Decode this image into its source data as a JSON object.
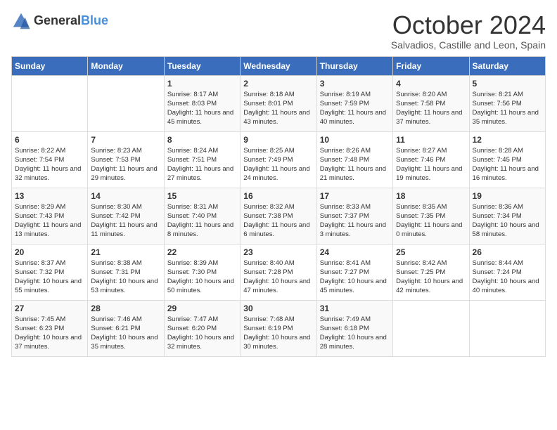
{
  "logo": {
    "general": "General",
    "blue": "Blue"
  },
  "title": "October 2024",
  "subtitle": "Salvadios, Castille and Leon, Spain",
  "days_header": [
    "Sunday",
    "Monday",
    "Tuesday",
    "Wednesday",
    "Thursday",
    "Friday",
    "Saturday"
  ],
  "weeks": [
    [
      {
        "day": "",
        "info": ""
      },
      {
        "day": "",
        "info": ""
      },
      {
        "day": "1",
        "info": "Sunrise: 8:17 AM\nSunset: 8:03 PM\nDaylight: 11 hours and 45 minutes."
      },
      {
        "day": "2",
        "info": "Sunrise: 8:18 AM\nSunset: 8:01 PM\nDaylight: 11 hours and 43 minutes."
      },
      {
        "day": "3",
        "info": "Sunrise: 8:19 AM\nSunset: 7:59 PM\nDaylight: 11 hours and 40 minutes."
      },
      {
        "day": "4",
        "info": "Sunrise: 8:20 AM\nSunset: 7:58 PM\nDaylight: 11 hours and 37 minutes."
      },
      {
        "day": "5",
        "info": "Sunrise: 8:21 AM\nSunset: 7:56 PM\nDaylight: 11 hours and 35 minutes."
      }
    ],
    [
      {
        "day": "6",
        "info": "Sunrise: 8:22 AM\nSunset: 7:54 PM\nDaylight: 11 hours and 32 minutes."
      },
      {
        "day": "7",
        "info": "Sunrise: 8:23 AM\nSunset: 7:53 PM\nDaylight: 11 hours and 29 minutes."
      },
      {
        "day": "8",
        "info": "Sunrise: 8:24 AM\nSunset: 7:51 PM\nDaylight: 11 hours and 27 minutes."
      },
      {
        "day": "9",
        "info": "Sunrise: 8:25 AM\nSunset: 7:49 PM\nDaylight: 11 hours and 24 minutes."
      },
      {
        "day": "10",
        "info": "Sunrise: 8:26 AM\nSunset: 7:48 PM\nDaylight: 11 hours and 21 minutes."
      },
      {
        "day": "11",
        "info": "Sunrise: 8:27 AM\nSunset: 7:46 PM\nDaylight: 11 hours and 19 minutes."
      },
      {
        "day": "12",
        "info": "Sunrise: 8:28 AM\nSunset: 7:45 PM\nDaylight: 11 hours and 16 minutes."
      }
    ],
    [
      {
        "day": "13",
        "info": "Sunrise: 8:29 AM\nSunset: 7:43 PM\nDaylight: 11 hours and 13 minutes."
      },
      {
        "day": "14",
        "info": "Sunrise: 8:30 AM\nSunset: 7:42 PM\nDaylight: 11 hours and 11 minutes."
      },
      {
        "day": "15",
        "info": "Sunrise: 8:31 AM\nSunset: 7:40 PM\nDaylight: 11 hours and 8 minutes."
      },
      {
        "day": "16",
        "info": "Sunrise: 8:32 AM\nSunset: 7:38 PM\nDaylight: 11 hours and 6 minutes."
      },
      {
        "day": "17",
        "info": "Sunrise: 8:33 AM\nSunset: 7:37 PM\nDaylight: 11 hours and 3 minutes."
      },
      {
        "day": "18",
        "info": "Sunrise: 8:35 AM\nSunset: 7:35 PM\nDaylight: 11 hours and 0 minutes."
      },
      {
        "day": "19",
        "info": "Sunrise: 8:36 AM\nSunset: 7:34 PM\nDaylight: 10 hours and 58 minutes."
      }
    ],
    [
      {
        "day": "20",
        "info": "Sunrise: 8:37 AM\nSunset: 7:32 PM\nDaylight: 10 hours and 55 minutes."
      },
      {
        "day": "21",
        "info": "Sunrise: 8:38 AM\nSunset: 7:31 PM\nDaylight: 10 hours and 53 minutes."
      },
      {
        "day": "22",
        "info": "Sunrise: 8:39 AM\nSunset: 7:30 PM\nDaylight: 10 hours and 50 minutes."
      },
      {
        "day": "23",
        "info": "Sunrise: 8:40 AM\nSunset: 7:28 PM\nDaylight: 10 hours and 47 minutes."
      },
      {
        "day": "24",
        "info": "Sunrise: 8:41 AM\nSunset: 7:27 PM\nDaylight: 10 hours and 45 minutes."
      },
      {
        "day": "25",
        "info": "Sunrise: 8:42 AM\nSunset: 7:25 PM\nDaylight: 10 hours and 42 minutes."
      },
      {
        "day": "26",
        "info": "Sunrise: 8:44 AM\nSunset: 7:24 PM\nDaylight: 10 hours and 40 minutes."
      }
    ],
    [
      {
        "day": "27",
        "info": "Sunrise: 7:45 AM\nSunset: 6:23 PM\nDaylight: 10 hours and 37 minutes."
      },
      {
        "day": "28",
        "info": "Sunrise: 7:46 AM\nSunset: 6:21 PM\nDaylight: 10 hours and 35 minutes."
      },
      {
        "day": "29",
        "info": "Sunrise: 7:47 AM\nSunset: 6:20 PM\nDaylight: 10 hours and 32 minutes."
      },
      {
        "day": "30",
        "info": "Sunrise: 7:48 AM\nSunset: 6:19 PM\nDaylight: 10 hours and 30 minutes."
      },
      {
        "day": "31",
        "info": "Sunrise: 7:49 AM\nSunset: 6:18 PM\nDaylight: 10 hours and 28 minutes."
      },
      {
        "day": "",
        "info": ""
      },
      {
        "day": "",
        "info": ""
      }
    ]
  ]
}
